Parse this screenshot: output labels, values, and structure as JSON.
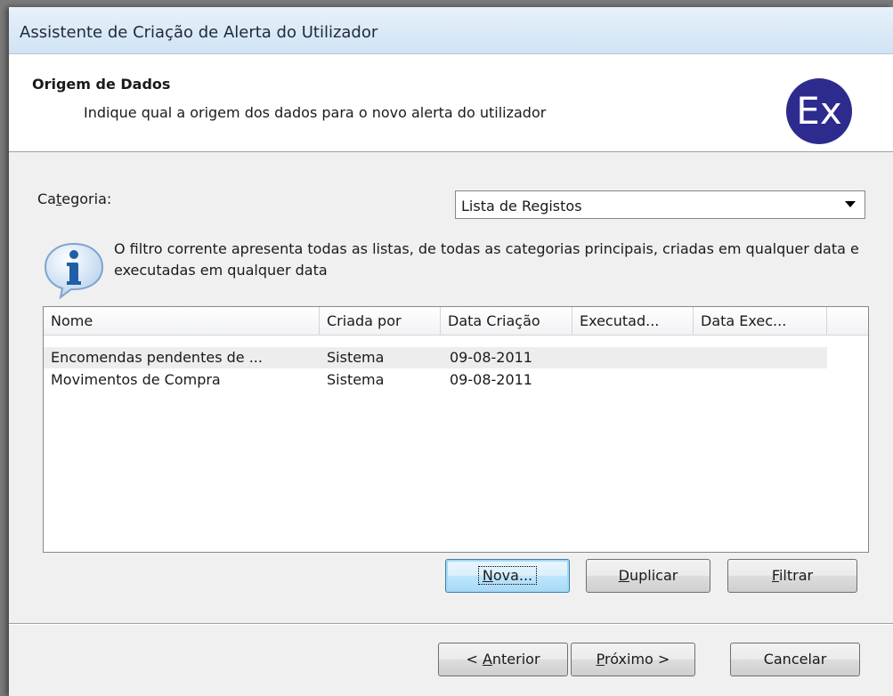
{
  "window": {
    "title": "Assistente de Criação de Alerta do Utilizador"
  },
  "header": {
    "title": "Origem de Dados",
    "subtitle": "Indique qual a origem dos dados para o novo alerta do utilizador",
    "logo_text": "Ex"
  },
  "category": {
    "label_pre": "Ca",
    "label_hot": "t",
    "label_post": "egoria:",
    "selected": "Lista de Registos"
  },
  "info": {
    "text": "O filtro corrente apresenta todas as listas, de todas as categorias principais, criadas em qualquer data e executadas em qualquer data"
  },
  "list": {
    "columns": [
      "Nome",
      "Criada por",
      "Data Criação",
      "Executad...",
      "Data Exec..."
    ],
    "rows": [
      [
        "Encomendas pendentes de ...",
        "Sistema",
        "09-08-2011",
        "",
        ""
      ],
      [
        "Movimentos de Compra",
        "Sistema",
        "09-08-2011",
        "",
        ""
      ]
    ]
  },
  "actions": {
    "nova": {
      "hot": "N",
      "rest": "ova..."
    },
    "duplicar": {
      "hot": "D",
      "rest": "uplicar"
    },
    "filtrar": {
      "hot": "F",
      "rest": "iltrar"
    }
  },
  "nav": {
    "anterior": {
      "pre": "< ",
      "hot": "A",
      "rest": "nterior"
    },
    "proximo": {
      "hot": "P",
      "rest": "róximo >"
    },
    "cancelar": "Cancelar"
  },
  "colors": {
    "logo_bg": "#2e2b8f",
    "title_bg": "#dce9f6",
    "info_icon": "#1f5fa8"
  }
}
